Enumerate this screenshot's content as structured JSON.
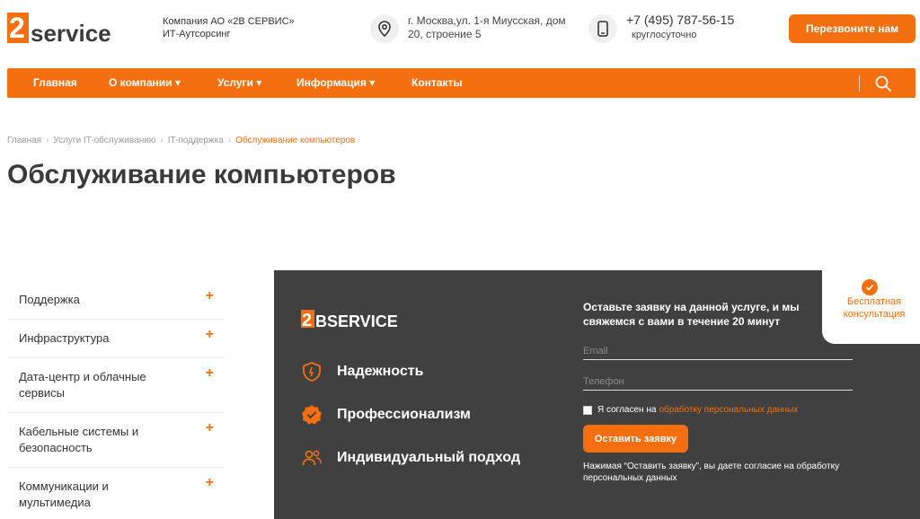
{
  "header": {
    "logo_text": "2Bservice",
    "company_line1": "Компания АО «2В СЕРВИС»",
    "company_line2": "ИТ-Аутсорсинг",
    "address_line1": "г. Москва,ул. 1-я Миусская, дом",
    "address_line2": "20, строение 5",
    "phone": "+7 (495) 787-56-15",
    "phone_note": "круглосуточно",
    "callback_label": "Перезвоните нам"
  },
  "nav": {
    "items": [
      {
        "label": "Главная"
      },
      {
        "label": "О компании ▾"
      },
      {
        "label": "Услуги ▾"
      },
      {
        "label": "Информация ▾"
      },
      {
        "label": "Контакты"
      }
    ]
  },
  "breadcrumb": {
    "items": [
      "Главная",
      "Услуги IT-обслуживанию",
      "IT-поддержка"
    ],
    "current": "Обслуживание компьютеров"
  },
  "page": {
    "title": "Обслуживание компьютеров"
  },
  "sidebar": {
    "items": [
      {
        "label": "Поддержка"
      },
      {
        "label": "Инфраструктура"
      },
      {
        "label": "Дата-центр и облачные сервисы"
      },
      {
        "label": "Кабельные системы и безопасность"
      },
      {
        "label": "Коммуникации и мультимедиа"
      }
    ],
    "expand_symbol": "+"
  },
  "promo": {
    "logo_text": "2BSERVICE",
    "features": [
      {
        "label": "Надежность",
        "icon": "shield-icon"
      },
      {
        "label": "Профессионализм",
        "icon": "badge-check-icon"
      },
      {
        "label": "Индивидуальный подход",
        "icon": "users-icon"
      }
    ],
    "form": {
      "title": "Оставьте заявку на данной услуге, и мы свяжемся с вами в течение 20 минут",
      "email_placeholder": "Email",
      "phone_placeholder": "Телефон",
      "consent_text": "Я согласен на",
      "consent_link": "обработку персональных данных",
      "submit_label": "Оставить заявку",
      "note": "Нажимая “Оставить заявку”, вы даете согласие на обработку персональных данных"
    },
    "consult": {
      "line1": "Бесплатная",
      "line2": "консультация"
    }
  },
  "colors": {
    "accent": "#f36f0f",
    "panel": "#404040"
  }
}
